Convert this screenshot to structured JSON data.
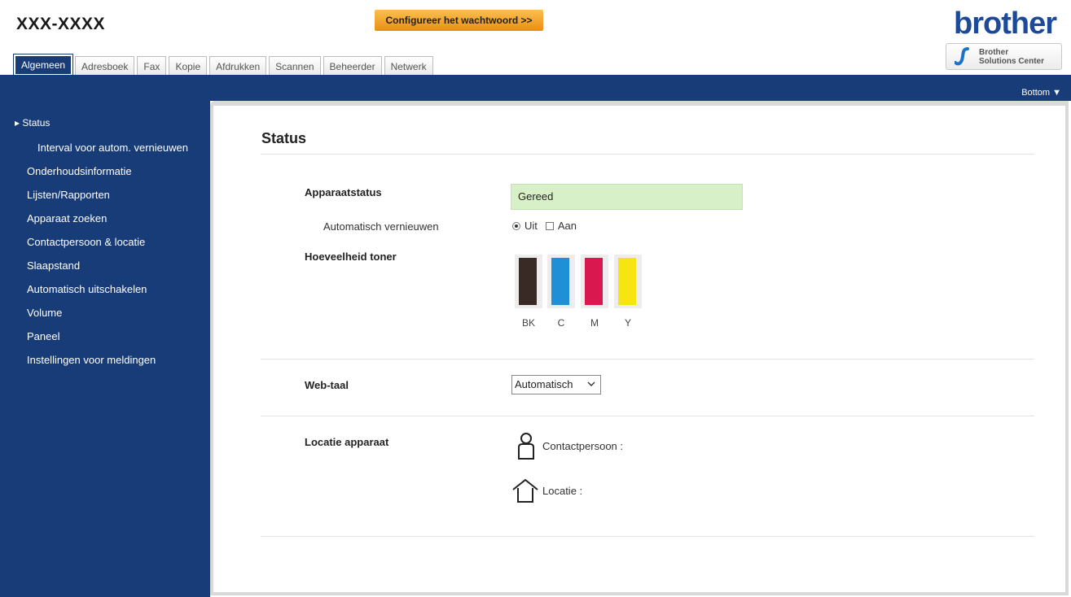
{
  "header": {
    "model": "XXX-XXXX",
    "password_button": "Configureer het wachtwoord >>",
    "logo": "brother",
    "solutions_center": {
      "line1": "Brother",
      "line2": "Solutions Center"
    }
  },
  "tabs": [
    {
      "label": "Algemeen",
      "active": true
    },
    {
      "label": "Adresboek",
      "active": false
    },
    {
      "label": "Fax",
      "active": false
    },
    {
      "label": "Kopie",
      "active": false
    },
    {
      "label": "Afdrukken",
      "active": false
    },
    {
      "label": "Scannen",
      "active": false
    },
    {
      "label": "Beheerder",
      "active": false
    },
    {
      "label": "Netwerk",
      "active": false
    }
  ],
  "bottom_link": "Bottom ▼",
  "sidebar": {
    "items": [
      {
        "label": "▸ Status",
        "selected": true
      },
      {
        "label": "Interval voor autom. vernieuwen"
      },
      {
        "label": "Onderhoudsinformatie"
      },
      {
        "label": "Lijsten/Rapporten"
      },
      {
        "label": "Apparaat zoeken"
      },
      {
        "label": "Contactpersoon & locatie"
      },
      {
        "label": "Slaapstand"
      },
      {
        "label": "Automatisch uitschakelen"
      },
      {
        "label": "Volume"
      },
      {
        "label": "Paneel"
      },
      {
        "label": "Instellingen voor meldingen"
      }
    ]
  },
  "main": {
    "title": "Status",
    "device_status": {
      "label": "Apparaatstatus",
      "value": "Gereed"
    },
    "auto_refresh": {
      "label": "Automatisch vernieuwen",
      "off": "Uit",
      "on": "Aan",
      "selected": "off"
    },
    "toner": {
      "label": "Hoeveelheid toner",
      "items": [
        {
          "name": "BK",
          "color": "#3a2a26"
        },
        {
          "name": "C",
          "color": "#1f8fd6"
        },
        {
          "name": "M",
          "color": "#d9184f"
        },
        {
          "name": "Y",
          "color": "#f7e413"
        }
      ]
    },
    "web_language": {
      "label": "Web-taal",
      "value": "Automatisch"
    },
    "location": {
      "label": "Locatie apparaat",
      "contact": "Contactpersoon :",
      "place": "Locatie :"
    }
  },
  "colors": {
    "nav_blue": "#183c77",
    "status_green": "#d8f0c8",
    "button_orange": "#f3a531"
  }
}
